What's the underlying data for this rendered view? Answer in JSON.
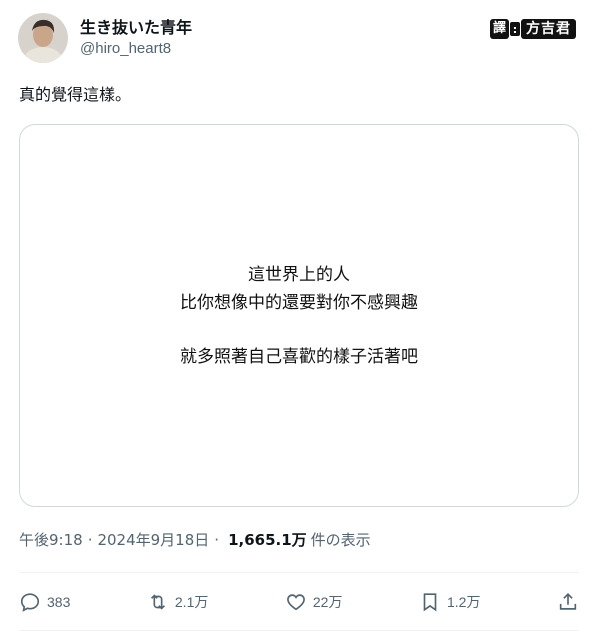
{
  "author": {
    "display_name": "生き抜いた青年",
    "handle": "@hiro_heart8"
  },
  "watermark": {
    "prefix": "譯",
    "colon": ":",
    "name": "方吉君"
  },
  "tweet": {
    "text": "真的覺得這樣。"
  },
  "image_quote": {
    "line1": "這世界上的人",
    "line2": "比你想像中的還要對你不感興趣",
    "line3": "就多照著自己喜歡的樣子活著吧"
  },
  "meta": {
    "time": "午後9:18",
    "separator": "·",
    "date": "2024年9月18日",
    "separator2": "·",
    "views": "1,665.1万",
    "views_label": "件の表示"
  },
  "actions": {
    "replies": "383",
    "reposts": "2.1万",
    "likes": "22万",
    "bookmarks": "1.2万"
  },
  "colors": {
    "text_primary": "#0f1419",
    "text_secondary": "#536471",
    "border": "#cfd9de"
  }
}
